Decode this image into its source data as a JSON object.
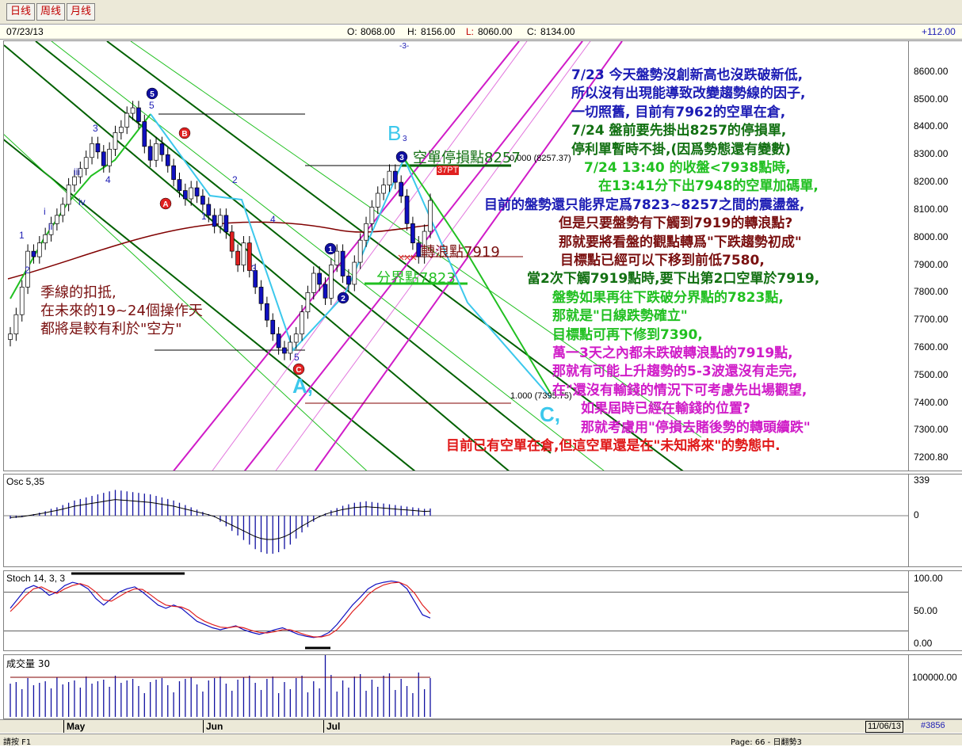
{
  "tabs": [
    "日线",
    "周线",
    "月线"
  ],
  "info": {
    "date": "07/23/13",
    "open_label": "O:",
    "open": "8068.00",
    "high_label": "H:",
    "high": "8156.00",
    "low_label": "L:",
    "low": "8060.00",
    "close_label": "C:",
    "close": "8134.00",
    "change": "+112.00"
  },
  "price_axis": [
    "8600.00",
    "8500.00",
    "8400.00",
    "8300.00",
    "8200.00",
    "8100.00",
    "8000.00",
    "7900.00",
    "7800.00",
    "7700.00",
    "7600.00",
    "7500.00",
    "7400.00",
    "7300.00",
    "7200.80"
  ],
  "osc": {
    "title": "Osc 5,35",
    "ticks": [
      "339",
      "0"
    ]
  },
  "stoch": {
    "title": "Stoch 14, 3, 3",
    "ticks": [
      "100.00",
      "50.00",
      "0.00"
    ]
  },
  "volume": {
    "title": "成交量",
    "param": "30",
    "ticks": [
      "100000.00"
    ]
  },
  "months": [
    "May",
    "Jun",
    "Jul"
  ],
  "bottom": {
    "date": "11/06/13",
    "code": "#3856"
  },
  "status": {
    "left": "請按 F1",
    "right": "Page: 66 - 日翻勢3"
  },
  "chart_labels": {
    "fib_top": "0.000 (8257.37)",
    "fib_bottom": "1.000 (7395.75)",
    "pt": "37PT",
    "minus3": "-3-",
    "wave_B": "B",
    "wave_A": "A,",
    "wave_C": "C,",
    "stop_line": "空單停損點8257",
    "turn_point": "轉浪點7919",
    "divide_point": "分界點7823",
    "waves": [
      "1",
      "2",
      "3",
      "4",
      "5",
      "3",
      "4",
      "5",
      "iii",
      "iv",
      "ii",
      "i",
      "1",
      "2",
      "1",
      "2",
      "3",
      "4",
      "5",
      "3"
    ],
    "circle_blue": [
      "5",
      "3",
      "1",
      "2"
    ],
    "circle_red": [
      "B",
      "A",
      "C"
    ]
  },
  "left_note": [
    "季線的扣抵,",
    "在未來的19~24個操作天",
    "都將是較有利於\"空方\""
  ],
  "commentary": [
    {
      "text": "7/23 今天盤勢沒創新高也沒跌破新低,",
      "color": "#1c1cb4"
    },
    {
      "text": "所以沒有出現能導致改變趨勢線的因子,",
      "color": "#1c1cb4"
    },
    {
      "text": "一切照舊, 目前有7962的空單在倉,",
      "color": "#1c1cb4"
    },
    {
      "text": "7/24 盤前要先掛出8257的停損單,",
      "color": "#127012"
    },
    {
      "text": "停利單暫時不掛,(因爲勢態還有變數)",
      "color": "#127012"
    },
    {
      "text": "7/24  13:40 的收盤<7938點時,",
      "color": "#21c021"
    },
    {
      "text": "在13:41分下出7948的空單加碼單,",
      "color": "#21c021"
    },
    {
      "text": "目前的盤勢還只能界定爲7823~8257之間的震盪盤,",
      "color": "#1c1cb4"
    },
    {
      "text": "但是只要盤勢有下觸到7919的轉浪點?",
      "color": "#7a1010"
    },
    {
      "text": "那就要將看盤的觀點轉爲\"下跌趨勢初成\"",
      "color": "#7a1010"
    },
    {
      "text": "目標點已經可以下移到前低7580,",
      "color": "#7a1010"
    },
    {
      "text": "當2次下觸7919點時,要下出第2口空單於7919,",
      "color": "#127012"
    },
    {
      "text": "盤勢如果再往下跌破分界點的7823點,",
      "color": "#21c021"
    },
    {
      "text": "那就是\"日線跌勢確立\"",
      "color": "#21c021"
    },
    {
      "text": "目標點可再下修到7390,",
      "color": "#21c021"
    },
    {
      "text": "萬一3天之內都未跌破轉浪點的7919點,",
      "color": "#d01cc8"
    },
    {
      "text": "那就有可能上升趨勢的5-3波還沒有走完,",
      "color": "#d01cc8"
    },
    {
      "text": "在\"還沒有輸錢的情況下可考慮先出場觀望,",
      "color": "#d01cc8"
    },
    {
      "text": "如果屆時已經在輸錢的位置?",
      "color": "#d01cc8"
    },
    {
      "text": "那就考慮用\"停損去賭後勢的轉頭續跌\"",
      "color": "#d01cc8"
    },
    {
      "text": "目前已有空單在倉,但這空單還是在\"未知將來\"的勢態中.",
      "color": "#e01818"
    }
  ],
  "colors": {
    "up_candle": "#ffffff",
    "down_candle": "#1010c0",
    "red_candle": "#e02020",
    "green_line": "#21c021",
    "cyan_line": "#3cc8ec",
    "magenta": "#d01cc8",
    "dark_green": "#006000",
    "ma": "#800000"
  },
  "chart_data": {
    "type": "candlestick",
    "x_axis_months": [
      "May",
      "Jun",
      "Jul"
    ],
    "y_range": [
      7200.8,
      8700
    ],
    "last_bar": {
      "date": "07/23/13",
      "open": 8068,
      "high": 8156,
      "low": 8060,
      "close": 8134,
      "change": 112
    },
    "closes": [
      7650,
      7720,
      7820,
      7950,
      7930,
      7980,
      8010,
      8050,
      8080,
      8120,
      8190,
      8220,
      8250,
      8290,
      8340,
      8310,
      8260,
      8320,
      8380,
      8400,
      8450,
      8470,
      8420,
      8330,
      8280,
      8340,
      8300,
      8260,
      8210,
      8170,
      8140,
      8180,
      8150,
      8120,
      8080,
      8040,
      8080,
      8020,
      7950,
      7900,
      7980,
      7880,
      7820,
      7760,
      7700,
      7650,
      7600,
      7580,
      7620,
      7650,
      7730,
      7800,
      7870,
      7830,
      7780,
      7900,
      7950,
      7860,
      7830,
      7910,
      7990,
      8050,
      8110,
      8160,
      8190,
      8240,
      8200,
      8150,
      8050,
      7980,
      7930,
      8022,
      8134
    ],
    "levels": [
      {
        "name": "空單停損點",
        "value": 8257
      },
      {
        "name": "轉浪點",
        "value": 7919
      },
      {
        "name": "分界點",
        "value": 7823
      },
      {
        "name": "fib 0.000",
        "value": 8257.37
      },
      {
        "name": "fib 1.000",
        "value": 7395.75
      }
    ],
    "osc": {
      "title": "Osc 5,35",
      "max": 339,
      "values": [
        -40,
        -30,
        -20,
        0,
        20,
        40,
        60,
        90,
        110,
        140,
        170,
        200,
        220,
        240,
        260,
        280,
        300,
        320,
        339,
        330,
        320,
        310,
        300,
        290,
        280,
        260,
        240,
        220,
        200,
        170,
        140,
        110,
        80,
        50,
        20,
        -20,
        -80,
        -140,
        -200,
        -260,
        -320,
        -380,
        -440,
        -480,
        -500,
        -500,
        -480,
        -440,
        -380,
        -300,
        -220,
        -150,
        -80,
        -20,
        30,
        70,
        100,
        130,
        150,
        170,
        180,
        190,
        180,
        170,
        160,
        150,
        140,
        130,
        120,
        110,
        100,
        90,
        95
      ]
    },
    "stoch": {
      "title": "Stoch 14, 3, 3",
      "k": [
        55,
        70,
        85,
        90,
        85,
        75,
        80,
        90,
        95,
        92,
        85,
        70,
        60,
        70,
        80,
        85,
        88,
        80,
        70,
        60,
        55,
        60,
        55,
        45,
        35,
        30,
        25,
        22,
        25,
        28,
        22,
        18,
        15,
        18,
        22,
        25,
        20,
        15,
        12,
        10,
        12,
        18,
        30,
        45,
        60,
        72,
        85,
        92,
        95,
        97,
        95,
        85,
        65,
        45,
        40
      ],
      "d": [
        50,
        62,
        75,
        85,
        88,
        82,
        78,
        85,
        90,
        93,
        89,
        80,
        68,
        66,
        73,
        80,
        85,
        84,
        76,
        67,
        60,
        58,
        57,
        52,
        42,
        35,
        30,
        26,
        25,
        27,
        25,
        21,
        18,
        17,
        19,
        22,
        22,
        18,
        14,
        11,
        11,
        14,
        22,
        35,
        50,
        62,
        76,
        85,
        91,
        94,
        95,
        90,
        78,
        60,
        47
      ]
    },
    "volume": {
      "title": "成交量",
      "param": 30,
      "ma_level": 100000
    }
  }
}
